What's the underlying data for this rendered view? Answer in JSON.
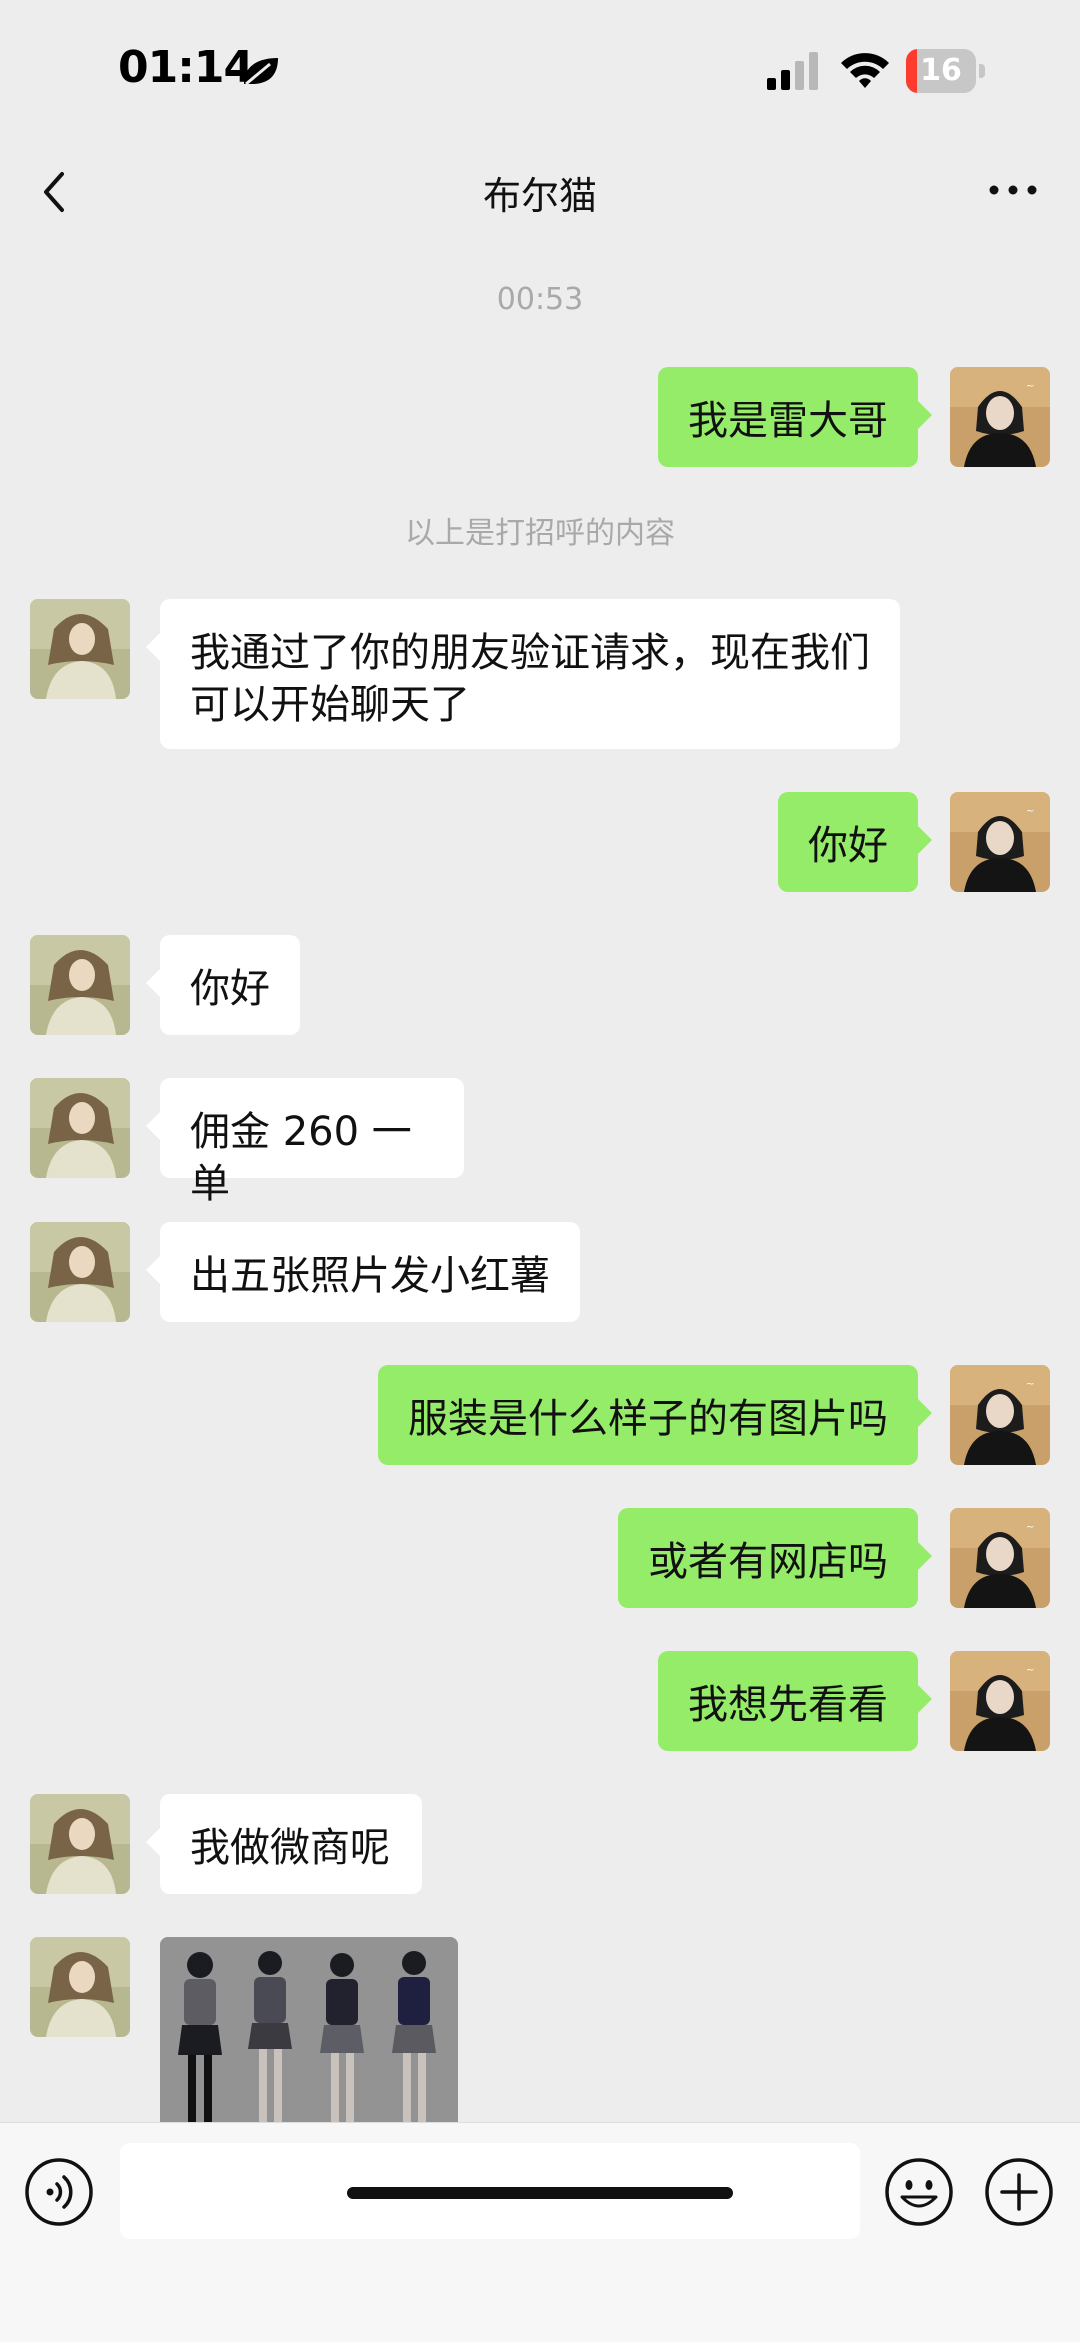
{
  "status_bar": {
    "time": "01:14",
    "battery": "16",
    "battery_level": 0.16
  },
  "header": {
    "title": "布尔猫",
    "back_icon": "chevron-left-icon",
    "more_icon": "ellipsis-icon"
  },
  "chat": {
    "timestamp": "00:53",
    "greeting_note": "以上是打招呼的内容",
    "messages": [
      {
        "from": "me",
        "text": "我是雷大哥"
      },
      {
        "from": "them",
        "text": "我通过了你的朋友验证请求，现在我们可以开始聊天了"
      },
      {
        "from": "me",
        "text": "你好"
      },
      {
        "from": "them",
        "text": "你好"
      },
      {
        "from": "them",
        "text": "佣金 260 一单"
      },
      {
        "from": "them",
        "text": "出五张照片发小红薯"
      },
      {
        "from": "me",
        "text": "服装是什么样子的有图片吗"
      },
      {
        "from": "me",
        "text": "或者有网店吗"
      },
      {
        "from": "me",
        "text": "我想先看看"
      },
      {
        "from": "them",
        "text": "我做微商呢"
      },
      {
        "from": "them",
        "type": "image"
      }
    ]
  },
  "input": {
    "placeholder": ""
  },
  "colors": {
    "background": "#ededed",
    "outgoing_bubble": "#95ec69",
    "incoming_bubble": "#ffffff",
    "system_text": "#a9a9a9"
  }
}
